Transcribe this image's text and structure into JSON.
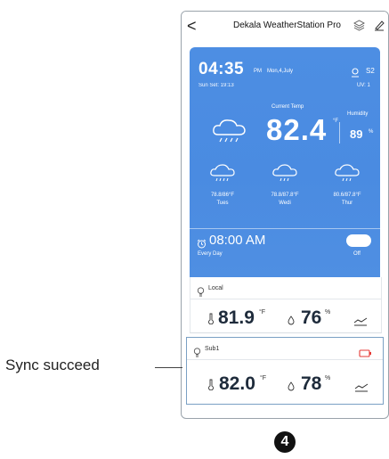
{
  "header": {
    "back_label": "<",
    "title": "Dekala WeatherStation Pro",
    "icons": [
      "layers-icon",
      "edit-icon"
    ]
  },
  "weather": {
    "time": "04:35",
    "ampm": "PM",
    "date": "Mon,4,July",
    "sunset": "Sun Set: 19:13",
    "location": "S2",
    "uv": "UV: 1",
    "current_label": "Current Temp",
    "current_temp": "82.4",
    "current_unit": "°F",
    "humidity_label": "Humidity",
    "humidity_value": "89",
    "humidity_unit": "%",
    "current_icon": "rain-cloud-icon",
    "forecast": [
      {
        "range": "78.8/86°F",
        "day": "Tues",
        "icon": "rain-cloud-icon"
      },
      {
        "range": "78.8/87.8°F",
        "day": "Wedi",
        "icon": "rain-cloud-icon"
      },
      {
        "range": "80.6/87.8°F",
        "day": "Thur",
        "icon": "rain-cloud-icon"
      }
    ]
  },
  "alarm": {
    "time": "08:00 AM",
    "repeat": "Every Day",
    "toggle_state": "Off"
  },
  "sensors": [
    {
      "name": "Local",
      "temp": "81.9",
      "temp_unit": "°F",
      "humidity": "76",
      "humidity_unit": "%"
    },
    {
      "name": "Sub1",
      "temp": "82.0",
      "temp_unit": "°F",
      "humidity": "78",
      "humidity_unit": "%",
      "battery_color": "#e53935"
    }
  ],
  "annotation": {
    "label": "Sync succeed",
    "step_number": "4"
  },
  "colors": {
    "accent": "#4a8be1",
    "highlight_border": "#7aa0c4"
  }
}
